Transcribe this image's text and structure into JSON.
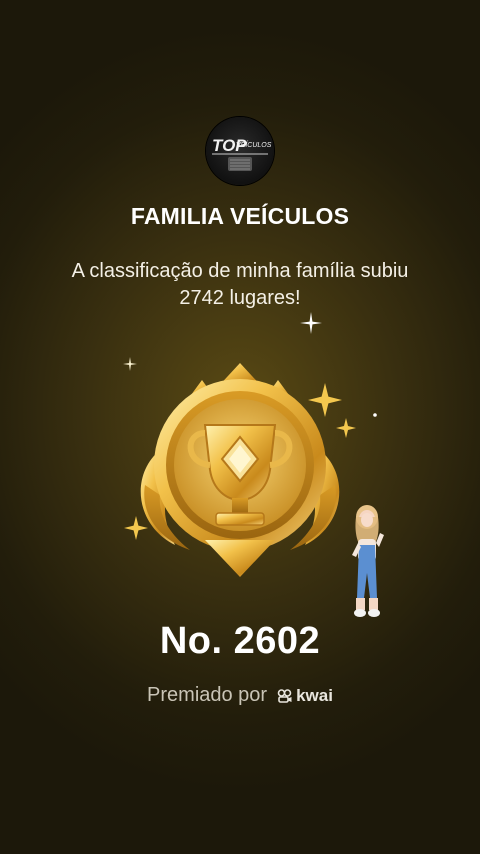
{
  "header": {
    "logo_text_top": "TOP",
    "logo_text_bottom": "VEÍCULOS",
    "family_name": "FAMILIA VEÍCULOS",
    "message": "A classificação de minha família subiu 2742 lugares!"
  },
  "badge": {
    "icon": "gold-trophy-medal",
    "rank_label": "No. 2602"
  },
  "footer": {
    "awarded_by_label": "Premiado por",
    "brand_name": "kwai"
  },
  "colors": {
    "background": "#2a230c",
    "gold": "#e8b93a",
    "text": "#ffffff",
    "muted_text": "#c9c4b6"
  }
}
